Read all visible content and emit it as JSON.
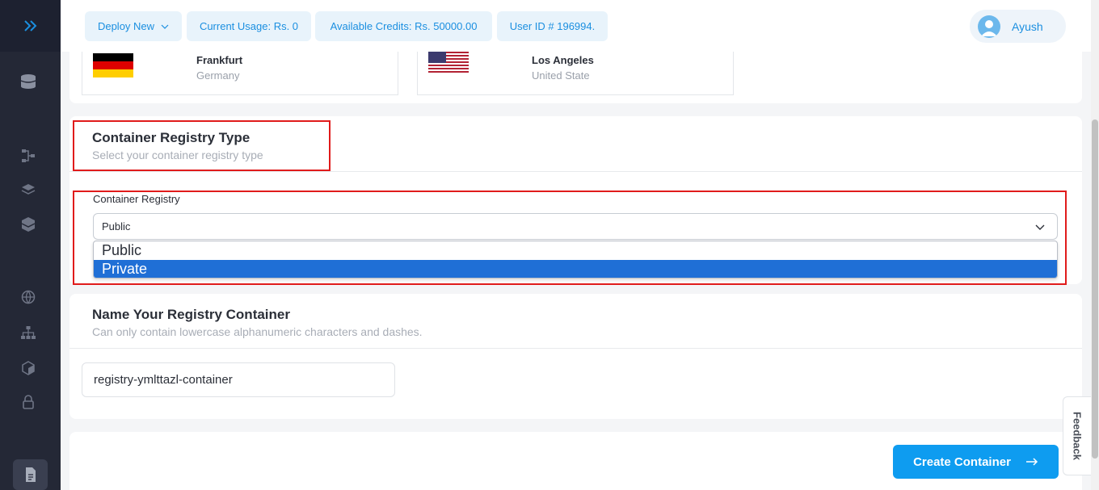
{
  "header": {
    "deploy_label": "Deploy New",
    "usage_label": "Current Usage: Rs. 0",
    "credits_label": "Available Credits: Rs. 50000.00",
    "user_id_label": "User ID # 196994.",
    "user_name": "Ayush"
  },
  "locations": [
    {
      "city": "Frankfurt",
      "country": "Germany",
      "flag": "germany-flag"
    },
    {
      "city": "Los Angeles",
      "country": "United State",
      "flag": "usa-flag"
    }
  ],
  "registry_type": {
    "title": "Container Registry Type",
    "subtitle": "Select your container registry type",
    "field_label": "Container Registry",
    "selected": "Public",
    "options": [
      "Public",
      "Private"
    ],
    "highlighted_option": "Private"
  },
  "registry_name": {
    "title": "Name Your Registry Container",
    "subtitle": "Can only contain lowercase alphanumeric characters and dashes.",
    "value": "registry-ymlttazl-container"
  },
  "actions": {
    "create_label": "Create Container"
  },
  "feedback_label": "Feedback",
  "colors": {
    "accent": "#0e9cf0",
    "sidebar": "#242836",
    "highlight": "#e01b1b",
    "dropdown_selected": "#1f6fd6"
  }
}
